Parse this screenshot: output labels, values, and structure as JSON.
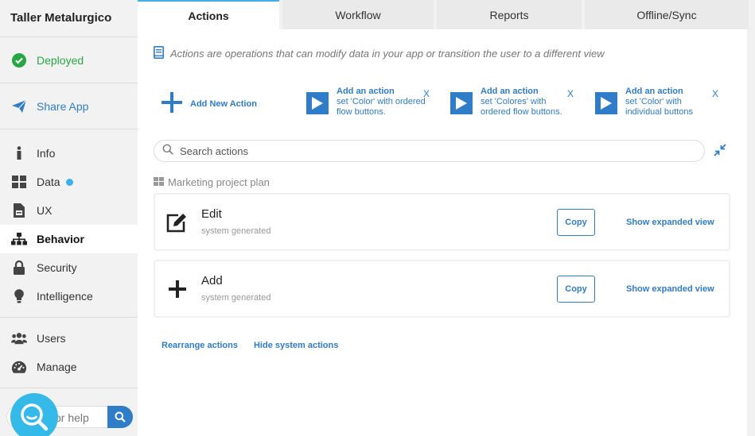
{
  "app": {
    "title": "Taller Metalurgico"
  },
  "sidebar": {
    "status": "Deployed",
    "share": "Share App",
    "items": [
      {
        "label": "Info",
        "icon": "info-icon"
      },
      {
        "label": "Data",
        "icon": "grid-icon"
      },
      {
        "label": "UX",
        "icon": "document-icon"
      },
      {
        "label": "Behavior",
        "icon": "sitemap-icon"
      },
      {
        "label": "Security",
        "icon": "lock-icon"
      },
      {
        "label": "Intelligence",
        "icon": "lightbulb-icon"
      }
    ],
    "items2": [
      {
        "label": "Users",
        "icon": "users-icon"
      },
      {
        "label": "Manage",
        "icon": "gauge-icon"
      }
    ],
    "help_text": "or help"
  },
  "tabs": [
    {
      "label": "Actions",
      "active": true
    },
    {
      "label": "Workflow",
      "active": false
    },
    {
      "label": "Reports",
      "active": false
    },
    {
      "label": "Offline/Sync",
      "active": false
    }
  ],
  "main": {
    "info": "Actions are operations that can modify data in your app or transition the user to a different view",
    "add_new": "Add New Action",
    "suggestions": [
      {
        "title": "Add an action",
        "desc": "set 'Color' with ordered flow buttons.",
        "close": "X"
      },
      {
        "title": "Add an action",
        "desc": "set 'Colores' with ordered flow buttons.",
        "close": "X"
      },
      {
        "title": "Add an action",
        "desc": "set 'Color' with individual buttons",
        "close": "X"
      }
    ],
    "search_placeholder": "Search actions",
    "section_title": "Marketing project plan",
    "actions": [
      {
        "name": "Edit",
        "sub": "system generated",
        "copy": "Copy",
        "expand": "Show expanded view",
        "icon": "edit-icon"
      },
      {
        "name": "Add",
        "sub": "system generated",
        "copy": "Copy",
        "expand": "Show expanded view",
        "icon": "plus-icon"
      }
    ],
    "links": {
      "rearrange": "Rearrange actions",
      "hide_system": "Hide system actions"
    }
  },
  "colors": {
    "accent": "#2f7cc8",
    "deployed": "#27a744",
    "dot": "#3fb0ea",
    "fab": "#35b9e9"
  }
}
